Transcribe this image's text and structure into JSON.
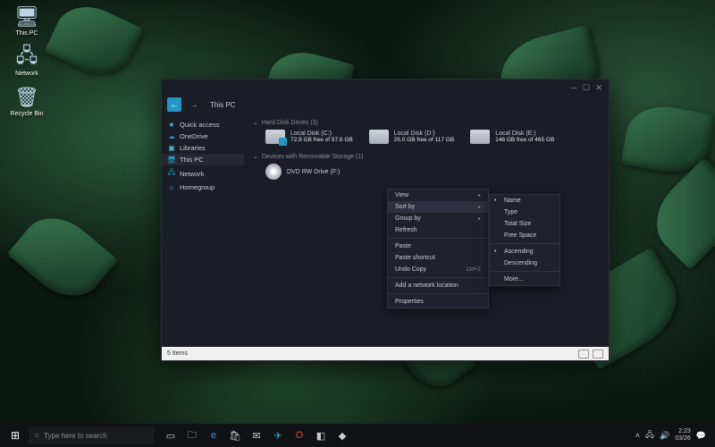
{
  "desktop": {
    "icons": [
      {
        "name": "This PC",
        "glyph": "🖥"
      },
      {
        "name": "Network",
        "glyph": "🖧"
      },
      {
        "name": "Recycle Bin",
        "glyph": "🗑"
      }
    ]
  },
  "window": {
    "breadcrumb": "This PC",
    "sidebar": [
      {
        "icon": "★",
        "label": "Quick access",
        "color": "ci-cyan"
      },
      {
        "icon": "☁",
        "label": "OneDrive",
        "color": "ci-blue"
      },
      {
        "icon": "▣",
        "label": "Libraries",
        "color": "ci-cyan"
      },
      {
        "icon": "🖥",
        "label": "This PC",
        "color": "ci-blue",
        "sel": true
      },
      {
        "icon": "🖧",
        "label": "Network",
        "color": "ci-blue"
      },
      {
        "icon": "⌂",
        "label": "Homegroup",
        "color": "ci-cyan"
      }
    ],
    "sections": {
      "hdd": {
        "header": "Hard Disk Drives (3)"
      },
      "removable": {
        "header": "Devices with Removable Storage (1)"
      }
    },
    "drives": [
      {
        "name": "Local Disk (C:)",
        "space": "72.9 GB free of 97.6 GB",
        "type": "sys"
      },
      {
        "name": "Local Disk (D:)",
        "space": "25.0 GB free of 117 GB",
        "type": "hdd"
      },
      {
        "name": "Local Disk (E:)",
        "space": "148 GB free of 465 GB",
        "type": "hdd"
      }
    ],
    "dvd": {
      "name": "DVD RW Drive (F:)"
    },
    "status": {
      "count": "5 Items"
    }
  },
  "contextMenu": {
    "items": [
      {
        "label": "View",
        "arrow": true
      },
      {
        "label": "Sort by",
        "arrow": true,
        "hl": true
      },
      {
        "label": "Group by",
        "arrow": true
      },
      {
        "label": "Refresh"
      },
      {
        "sep": true
      },
      {
        "label": "Paste"
      },
      {
        "label": "Paste shortcut"
      },
      {
        "label": "Undo Copy",
        "shortcut": "Ctrl+Z"
      },
      {
        "sep": true
      },
      {
        "label": "Add a network location"
      },
      {
        "sep": true
      },
      {
        "label": "Properties"
      }
    ]
  },
  "submenu": {
    "items": [
      {
        "label": "Name",
        "bullet": true
      },
      {
        "label": "Type"
      },
      {
        "label": "Total Size"
      },
      {
        "label": "Free Space"
      },
      {
        "sep": true
      },
      {
        "label": "Ascending",
        "bullet": true
      },
      {
        "label": "Descending"
      },
      {
        "sep": true
      },
      {
        "label": "More..."
      }
    ]
  },
  "taskbar": {
    "search_placeholder": "Type here to search",
    "clock": {
      "time": "2:23",
      "date": "03/26"
    }
  }
}
